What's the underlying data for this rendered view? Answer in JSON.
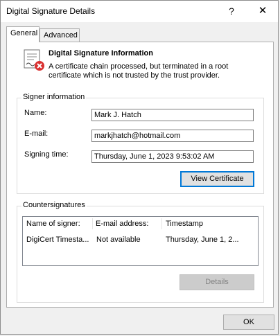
{
  "window": {
    "title": "Digital Signature Details",
    "help_label": "?",
    "close_label": "✕"
  },
  "tabs": [
    {
      "label": "General"
    },
    {
      "label": "Advanced"
    }
  ],
  "info": {
    "title": "Digital Signature Information",
    "text": "A certificate chain processed, but terminated in a root certificate which is not trusted by the trust provider."
  },
  "signer": {
    "legend": "Signer information",
    "name_label": "Name:",
    "name_value": "Mark J. Hatch",
    "email_label": "E-mail:",
    "email_value": "markjhatch@hotmail.com",
    "time_label": "Signing time:",
    "time_value": "Thursday, June 1, 2023 9:53:02 AM",
    "view_certificate_label": "View Certificate"
  },
  "countersignatures": {
    "legend": "Countersignatures",
    "columns": [
      "Name of signer:",
      "E-mail address:",
      "Timestamp"
    ],
    "rows": [
      [
        "DigiCert Timesta...",
        "Not available",
        "Thursday, June 1, 2..."
      ]
    ],
    "details_label": "Details"
  },
  "ok_label": "OK"
}
